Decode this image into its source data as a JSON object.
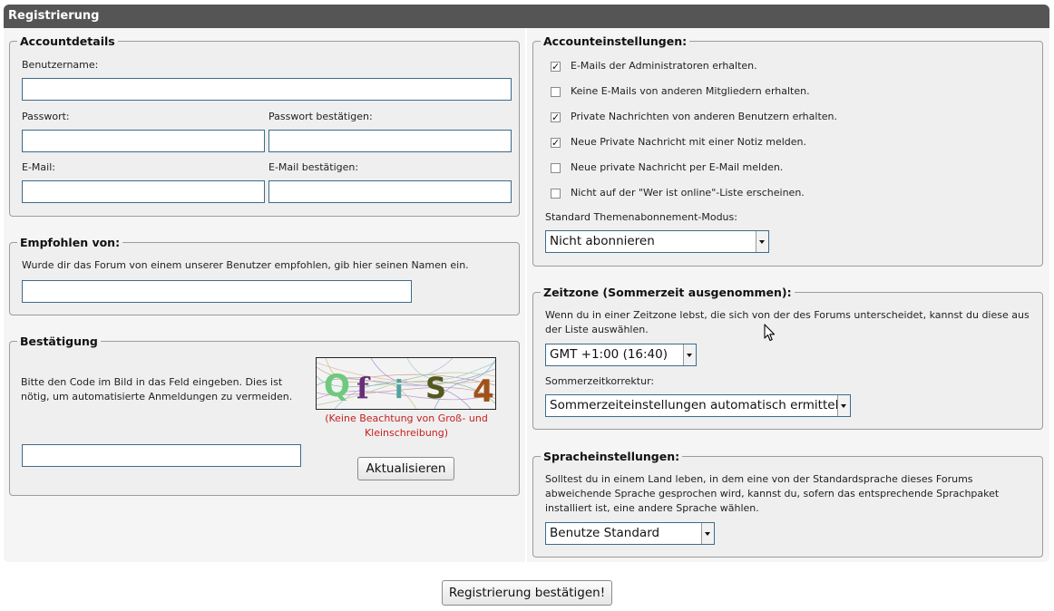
{
  "header": {
    "title": "Registrierung"
  },
  "account_details": {
    "legend": "Accountdetails",
    "username_label": "Benutzername:",
    "password_label": "Passwort:",
    "password_confirm_label": "Passwort bestätigen:",
    "email_label": "E-Mail:",
    "email_confirm_label": "E-Mail bestätigen:"
  },
  "recommended": {
    "legend": "Empfohlen von:",
    "description": "Wurde dir das Forum von einem unserer Benutzer empfohlen, gib hier seinen Namen ein."
  },
  "confirmation": {
    "legend": "Bestätigung",
    "description": "Bitte den Code im Bild in das Feld eingeben. Dies ist nötig, um automatisierte Anmeldungen zu vermeiden.",
    "captcha_chars": [
      "Q",
      "f",
      "i",
      "S",
      "4"
    ],
    "captcha_note": "(Keine Beachtung von Groß- und Kleinschreibung)",
    "refresh_label": "Aktualisieren"
  },
  "account_settings": {
    "legend": "Accounteinstellungen:",
    "options": [
      {
        "label": "E-Mails der Administratoren erhalten.",
        "checked": true
      },
      {
        "label": "Keine E-Mails von anderen Mitgliedern erhalten.",
        "checked": false
      },
      {
        "label": "Private Nachrichten von anderen Benutzern erhalten.",
        "checked": true
      },
      {
        "label": "Neue Private Nachricht mit einer Notiz melden.",
        "checked": true
      },
      {
        "label": "Neue private Nachricht per E-Mail melden.",
        "checked": false
      },
      {
        "label": "Nicht auf der \"Wer ist online\"-Liste erscheinen.",
        "checked": false
      }
    ],
    "subscription_label": "Standard Themenabonnement-Modus:",
    "subscription_value": "Nicht abonnieren"
  },
  "timezone": {
    "legend": "Zeitzone (Sommerzeit ausgenommen):",
    "description": "Wenn du in einer Zeitzone lebst, die sich von der des Forums unterscheidet, kannst du diese aus der Liste auswählen.",
    "timezone_value": "GMT +1:00 (16:40)",
    "dst_label": "Sommerzeitkorrektur:",
    "dst_value": "Sommerzeiteinstellungen automatisch ermitteln"
  },
  "language": {
    "legend": "Spracheinstellungen:",
    "description": "Solltest du in einem Land leben, in dem eine von der Standardsprache dieses Forums abweichende Sprache gesprochen wird, kannst du, sofern das entsprechende Sprachpaket installiert ist, eine andere Sprache wählen.",
    "language_value": "Benutze Standard"
  },
  "submit_label": "Registrierung bestätigen!"
}
